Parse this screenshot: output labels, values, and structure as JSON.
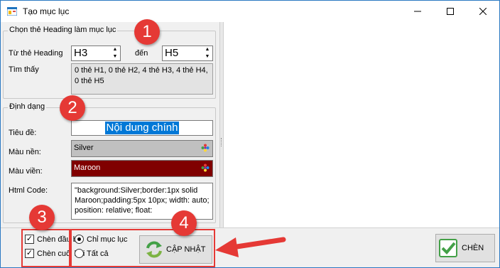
{
  "window": {
    "title": "Tạo mục lục"
  },
  "heading_group": {
    "legend": "Chọn thẻ Heading làm mục lục",
    "from_label": "Từ thẻ Heading",
    "from_value": "H3",
    "to_label": "đến",
    "to_value": "H5",
    "found_label": "Tìm thấy",
    "found_text": "0 thẻ H1, 0 thẻ H2, 4 thẻ H3, 4 thẻ H4, 0 thẻ H5"
  },
  "format_group": {
    "legend": "Định dạng",
    "title_label": "Tiêu đề:",
    "title_value": "Nội dung chính",
    "bg_label": "Màu nền:",
    "bg_value": "Silver",
    "bg_color": "#c0c0c0",
    "border_label": "Màu viền:",
    "border_value": "Maroon",
    "border_color": "#800000",
    "html_label": "Html Code:",
    "html_value": "\"background:Silver;border:1px solid Maroon;padding:5px 10px; width: auto; position: relative; float:"
  },
  "options": {
    "insert_top_label": "Chèn đầu bài",
    "insert_bottom_label": "Chèn cuối bài",
    "radio_headings_only_label": "Chỉ mục lục",
    "radio_all_label": "Tất cả",
    "update_button_label": "CẬP NHẬT",
    "insert_button_label": "CHÈN"
  },
  "annotations": {
    "badges": [
      "1",
      "2",
      "3",
      "4"
    ],
    "accent_color": "#e53935"
  }
}
